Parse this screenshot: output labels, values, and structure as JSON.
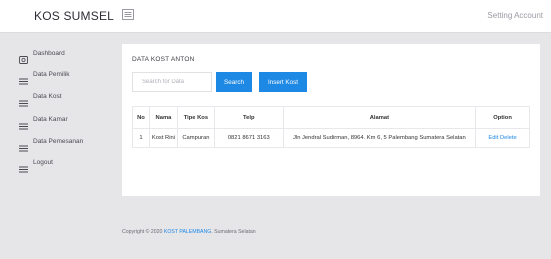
{
  "header": {
    "brand": "KOS SUMSEL",
    "setting_account": "Setting Account"
  },
  "sidebar": {
    "items": [
      {
        "label": "Dashboard",
        "icon": "dashboard-icon"
      },
      {
        "label": "Data Pemilik",
        "icon": "list-icon"
      },
      {
        "label": "Data Kost",
        "icon": "list-icon"
      },
      {
        "label": "Data Kamar",
        "icon": "list-icon"
      },
      {
        "label": "Data Pemesanan",
        "icon": "list-icon"
      },
      {
        "label": "Logout",
        "icon": "list-icon"
      }
    ]
  },
  "main": {
    "title": "DATA KOST ANTON",
    "search_placeholder": "Search for Data",
    "search_button": "Search",
    "insert_button": "Insert Kost",
    "table": {
      "headers": [
        "No",
        "Nama",
        "Tipe Kos",
        "Telp",
        "Alamat",
        "Option"
      ],
      "rows": [
        {
          "no": "1",
          "nama": "Kost Rini",
          "tipe": "Campuran",
          "telp": "0821 8671 3163",
          "alamat": "Jln Jendral Sudirman, 8964. Km 6, 5 Palembang Sumatera Selatan",
          "edit": "Edit",
          "delete": "Delete"
        }
      ]
    }
  },
  "footer": {
    "prefix": "Copyright © 2020",
    "link": "KOST PALEMBANG",
    "suffix": ". Sumatera Selatan"
  },
  "colors": {
    "accent": "#1e88e5",
    "background": "#e6e6e9"
  }
}
